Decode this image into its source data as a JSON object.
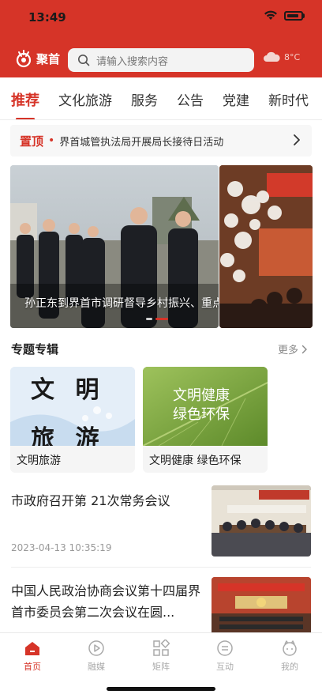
{
  "status_bar": {
    "time": "13:49"
  },
  "header": {
    "logo_text": "聚首",
    "search_placeholder": "请输入搜索内容",
    "weather_text": "8°C"
  },
  "tabs": [
    {
      "label": "推荐",
      "active": true
    },
    {
      "label": "文化旅游",
      "active": false
    },
    {
      "label": "服务",
      "active": false
    },
    {
      "label": "公告",
      "active": false
    },
    {
      "label": "党建",
      "active": false
    },
    {
      "label": "新时代",
      "active": false
    }
  ],
  "pinned": {
    "label": "置顶",
    "dot": "•",
    "text": "界首城管执法局开展局长接待日活动"
  },
  "carousel": {
    "caption": "孙正东到界首市调研督导乡村振兴、重点项目...",
    "slide_count": 2,
    "active_index": 1
  },
  "topics": {
    "title": "专题专辑",
    "more_label": "更多",
    "items": [
      {
        "label": "文明旅游",
        "image_text_top": "文 明",
        "image_text_bottom": "旅 游"
      },
      {
        "label": "文明健康 绿色环保",
        "image_text_line1": "文明健康",
        "image_text_line2": "绿色环保"
      }
    ]
  },
  "news": [
    {
      "title": "市政府召开第 21次常务会议",
      "date": "2023-04-13 10:35:19"
    },
    {
      "title": "中国人民政治协商会议第十四届界首市委员会第二次会议在圆...",
      "date": ""
    }
  ],
  "bottom_nav": [
    {
      "label": "首页",
      "icon": "home-icon",
      "active": true
    },
    {
      "label": "融媒",
      "icon": "play-circle-icon",
      "active": false
    },
    {
      "label": "矩阵",
      "icon": "grid-icon",
      "active": false
    },
    {
      "label": "互动",
      "icon": "chat-icon",
      "active": false
    },
    {
      "label": "我的",
      "icon": "user-icon",
      "active": false
    }
  ],
  "colors": {
    "accent": "#d63428",
    "inactive": "#aaaaaa"
  }
}
